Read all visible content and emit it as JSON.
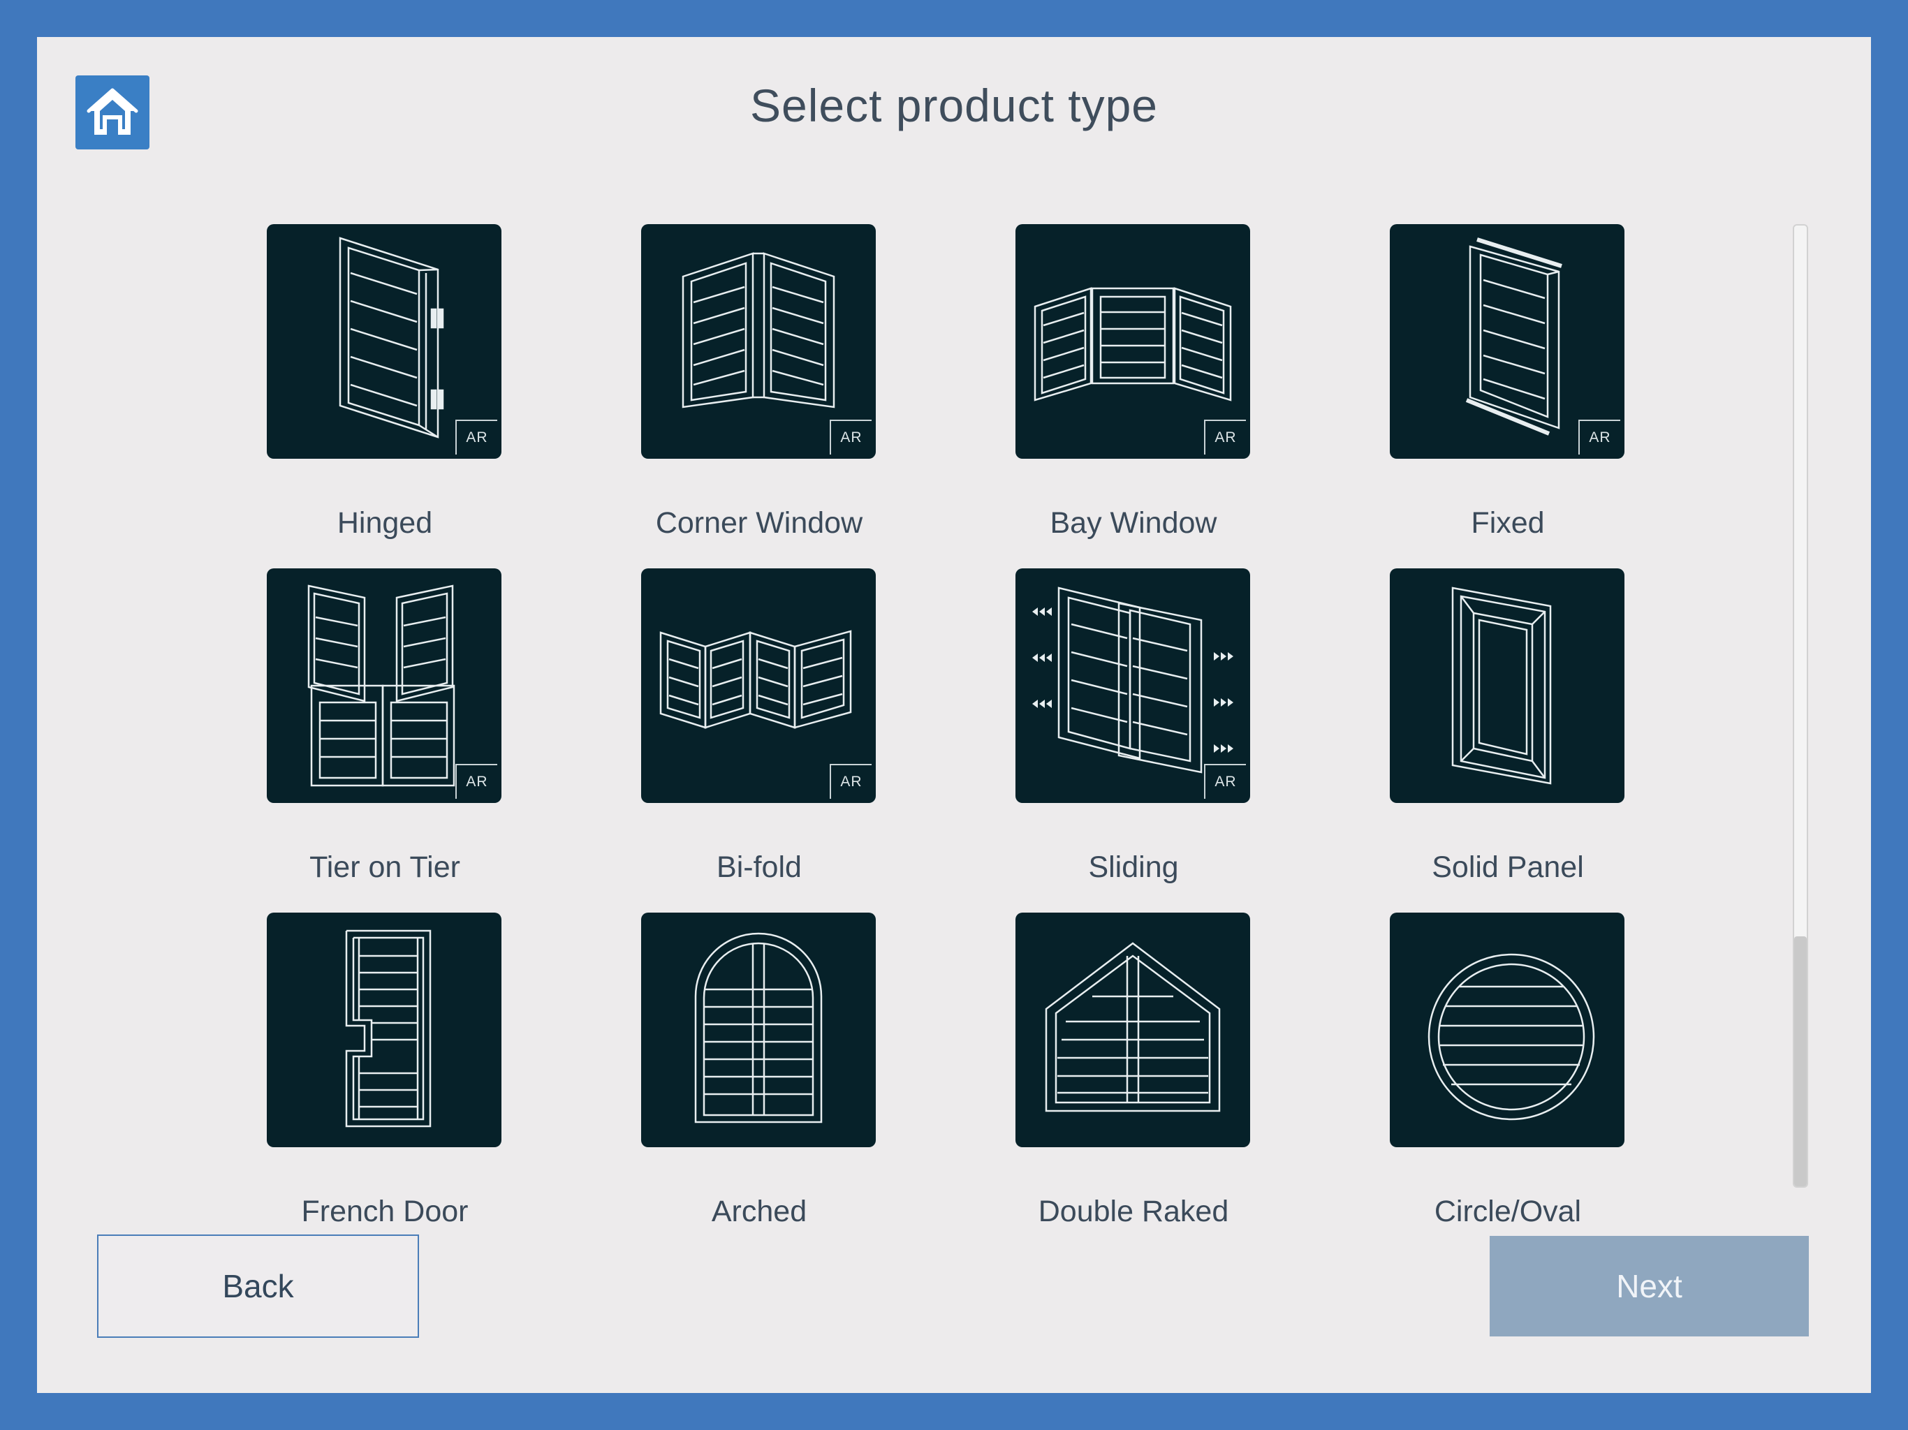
{
  "header": {
    "title": "Select product type",
    "home_icon": "home-icon"
  },
  "products": [
    {
      "id": "hinged",
      "label": "Hinged",
      "ar": "AR",
      "icon": "hinged-shutter-icon"
    },
    {
      "id": "corner-window",
      "label": "Corner Window",
      "ar": "AR",
      "icon": "corner-window-shutter-icon"
    },
    {
      "id": "bay-window",
      "label": "Bay Window",
      "ar": "AR",
      "icon": "bay-window-shutter-icon"
    },
    {
      "id": "fixed",
      "label": "Fixed",
      "ar": "AR",
      "icon": "fixed-shutter-icon"
    },
    {
      "id": "tier-on-tier",
      "label": "Tier on Tier",
      "ar": "AR",
      "icon": "tier-on-tier-shutter-icon"
    },
    {
      "id": "bi-fold",
      "label": "Bi-fold",
      "ar": "AR",
      "icon": "bi-fold-shutter-icon"
    },
    {
      "id": "sliding",
      "label": "Sliding",
      "ar": "AR",
      "icon": "sliding-shutter-icon"
    },
    {
      "id": "solid-panel",
      "label": "Solid Panel",
      "ar": null,
      "icon": "solid-panel-icon"
    },
    {
      "id": "french-door",
      "label": "French Door",
      "ar": null,
      "icon": "french-door-icon"
    },
    {
      "id": "arched",
      "label": "Arched",
      "ar": null,
      "icon": "arched-shutter-icon"
    },
    {
      "id": "double-raked",
      "label": "Double Raked",
      "ar": null,
      "icon": "double-raked-shutter-icon"
    },
    {
      "id": "circle-oval",
      "label": "Circle/Oval",
      "ar": null,
      "icon": "circle-oval-shutter-icon"
    }
  ],
  "scrollbar": {
    "visible_fraction": 0.74,
    "position_fraction": 0.0
  },
  "footer": {
    "back_label": "Back",
    "next_label": "Next"
  },
  "colors": {
    "frame": "#4078bd",
    "background": "#edebec",
    "tile": "#062129",
    "home_button": "#3a7fc5",
    "next_button_disabled": "#8fa7bf",
    "back_border": "#4a7db8"
  }
}
